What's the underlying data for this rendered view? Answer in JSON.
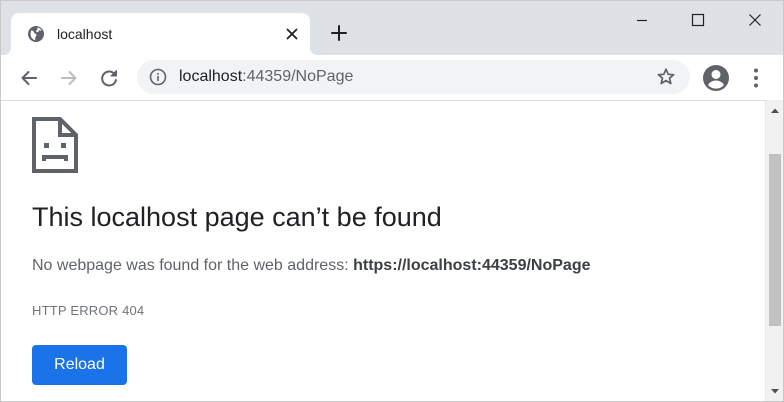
{
  "browser": {
    "tab": {
      "title": "localhost",
      "favicon": "globe-icon"
    },
    "new_tab_icon": "plus-icon",
    "window_controls": [
      "minimize-icon",
      "maximize-icon",
      "close-icon"
    ],
    "nav_icons": [
      "back-arrow-icon",
      "forward-arrow-icon",
      "reload-icon"
    ],
    "omnibox": {
      "host": "localhost",
      "path": ":44359/NoPage",
      "info_icon": "info-icon",
      "bookmark_icon": "star-icon"
    },
    "profile_icon": "account-circle-icon",
    "menu_icon": "more-vert-icon"
  },
  "error_page": {
    "icon": "sad-document-icon",
    "headline": "This localhost page can’t be found",
    "description_prefix": "No webpage was found for the web address: ",
    "description_url": "https://localhost:44359/NoPage",
    "error_code": "HTTP ERROR 404",
    "reload_label": "Reload"
  },
  "colors": {
    "tabstrip": "#dee1e6",
    "omnibox": "#f1f3f4",
    "accent": "#1a73e8",
    "headline": "#202124",
    "secondary_text": "#5f6368"
  }
}
